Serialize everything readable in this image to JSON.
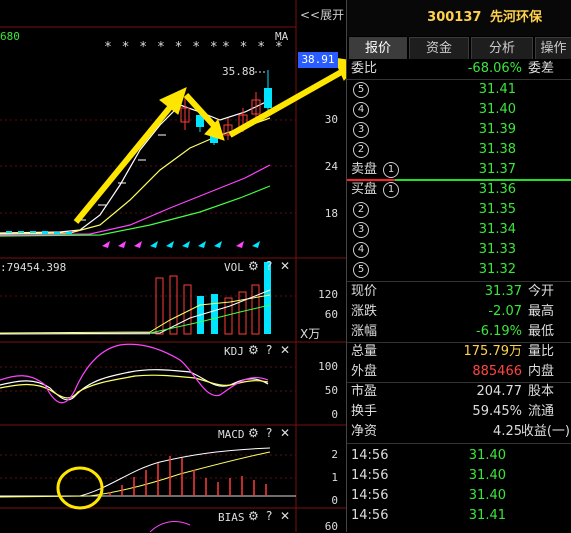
{
  "left_panel": {
    "expand_button": "<<展开",
    "top_left_value": "680",
    "ma_label": "MA",
    "price_marker": "38.91",
    "peak_label": "35.88",
    "star_row_1": "* * * * * * *",
    "star_row_2": "* * * *",
    "price_axis": [
      "30",
      "24",
      "18"
    ],
    "vol_header": ":79454.398",
    "vol_label": "VOL",
    "vol_axis": [
      "120",
      "60"
    ],
    "vol_unit": "X万",
    "kdj_label": "KDJ",
    "kdj_axis": [
      "100",
      "50",
      "0"
    ],
    "macd_label": "MACD",
    "macd_axis": [
      "2",
      "1",
      "0"
    ],
    "bias_label": "BIAS",
    "bias_axis_top": "60",
    "tool_settings": "⚙",
    "tool_help": "?",
    "tool_close": "✕"
  },
  "right_panel": {
    "stock_code": "300137",
    "stock_name": "先河环保",
    "tabs": [
      "报价",
      "资金",
      "分析",
      "操作"
    ],
    "wei_bi": {
      "label": "委比",
      "value": "-68.06%",
      "label2": "委差"
    },
    "sell_orders": [
      {
        "level": "5",
        "price": "31.41"
      },
      {
        "level": "4",
        "price": "31.40"
      },
      {
        "level": "3",
        "price": "31.39"
      },
      {
        "level": "2",
        "price": "31.38"
      },
      {
        "level": "1",
        "price": "31.37",
        "label": "卖盘"
      }
    ],
    "buy_orders": [
      {
        "level": "1",
        "price": "31.36",
        "label": "买盘"
      },
      {
        "level": "2",
        "price": "31.35"
      },
      {
        "level": "3",
        "price": "31.34"
      },
      {
        "level": "4",
        "price": "31.33"
      },
      {
        "level": "5",
        "price": "31.32"
      }
    ],
    "stats": [
      {
        "label": "现价",
        "value": "31.37",
        "label2": "今开",
        "color": "green"
      },
      {
        "label": "涨跌",
        "value": "-2.07",
        "label2": "最高",
        "color": "green"
      },
      {
        "label": "涨幅",
        "value": "-6.19%",
        "label2": "最低",
        "color": "green"
      },
      {
        "label": "总量",
        "value": "175.79万",
        "label2": "量比",
        "color": "yellow"
      },
      {
        "label": "外盘",
        "value": "885466",
        "label2": "内盘",
        "color": "red"
      },
      {
        "label": "市盈",
        "value": "204.77",
        "label2": "股本",
        "color": "white"
      },
      {
        "label": "换手",
        "value": "59.45%",
        "label2": "流通",
        "color": "white"
      },
      {
        "label": "净资",
        "value": "4.25",
        "label2": "收益(一)",
        "color": "white"
      }
    ],
    "ticks": [
      {
        "time": "14:56",
        "price": "31.40"
      },
      {
        "time": "14:56",
        "price": "31.40"
      },
      {
        "time": "14:56",
        "price": "31.40"
      },
      {
        "time": "14:56",
        "price": "31.41"
      }
    ]
  },
  "colors": {
    "up": "#ff3b3b",
    "down": "#00e5ff",
    "green_text": "#3be63b",
    "arrow": "#ffe600"
  }
}
